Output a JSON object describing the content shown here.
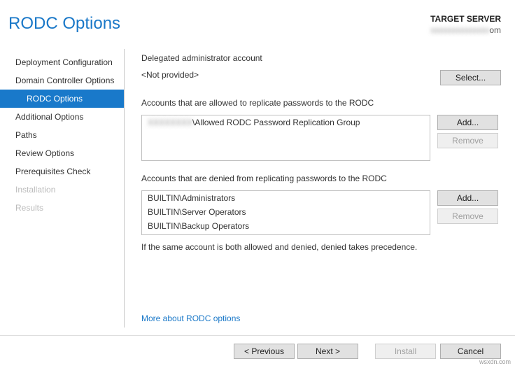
{
  "header": {
    "title": "RODC Options",
    "target_label": "TARGET SERVER",
    "target_value": "om"
  },
  "sidebar": {
    "items": [
      {
        "label": "Deployment Configuration",
        "selected": false,
        "disabled": false,
        "indented": false
      },
      {
        "label": "Domain Controller Options",
        "selected": false,
        "disabled": false,
        "indented": false
      },
      {
        "label": "RODC Options",
        "selected": true,
        "disabled": false,
        "indented": true
      },
      {
        "label": "Additional Options",
        "selected": false,
        "disabled": false,
        "indented": false
      },
      {
        "label": "Paths",
        "selected": false,
        "disabled": false,
        "indented": false
      },
      {
        "label": "Review Options",
        "selected": false,
        "disabled": false,
        "indented": false
      },
      {
        "label": "Prerequisites Check",
        "selected": false,
        "disabled": false,
        "indented": false
      },
      {
        "label": "Installation",
        "selected": false,
        "disabled": true,
        "indented": false
      },
      {
        "label": "Results",
        "selected": false,
        "disabled": true,
        "indented": false
      }
    ]
  },
  "main": {
    "delegated_label": "Delegated administrator account",
    "delegated_value": "<Not provided>",
    "select_btn": "Select...",
    "allowed_label": "Accounts that are allowed to replicate passwords to the RODC",
    "allowed_items": [
      "\\Allowed RODC Password Replication Group"
    ],
    "denied_label": "Accounts that are denied from replicating passwords to the RODC",
    "denied_items": [
      "BUILTIN\\Administrators",
      "BUILTIN\\Server Operators",
      "BUILTIN\\Backup Operators"
    ],
    "add_btn": "Add...",
    "remove_btn": "Remove",
    "note": "If the same account is both allowed and denied, denied takes precedence.",
    "more_link": "More about RODC options"
  },
  "footer": {
    "previous": "< Previous",
    "next": "Next >",
    "install": "Install",
    "cancel": "Cancel"
  },
  "watermark": "wsxdn.com"
}
